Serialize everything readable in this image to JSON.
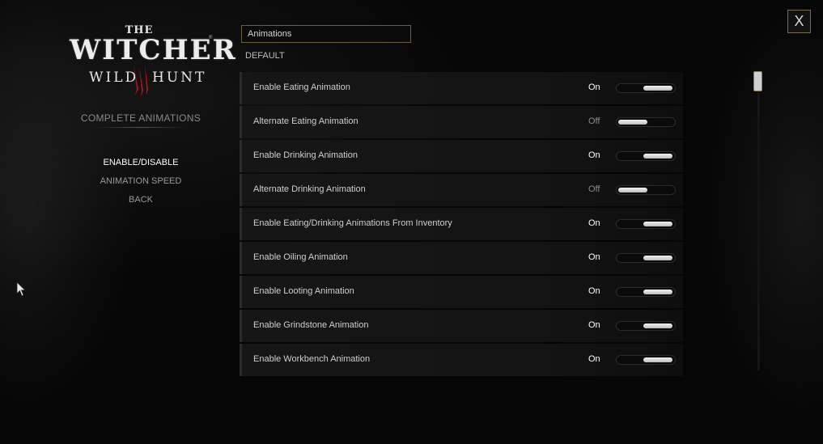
{
  "logo": {
    "the": "THE",
    "witcher": "WITCHER",
    "wild": "WILD",
    "hunt": "HUNT"
  },
  "menu": {
    "title": "COMPLETE ANIMATIONS",
    "items": [
      {
        "label": "ENABLE/DISABLE",
        "active": true
      },
      {
        "label": "ANIMATION SPEED",
        "active": false
      },
      {
        "label": "BACK",
        "active": false
      }
    ]
  },
  "search": {
    "value": "Animations"
  },
  "default_label": "DEFAULT",
  "close_label": "X",
  "colors": {
    "accent_border": "#7b6c4e",
    "on_text": "#ffffff",
    "off_text": "#8c8c8c"
  },
  "options": [
    {
      "label": "Enable Eating Animation",
      "state": "On"
    },
    {
      "label": "Alternate Eating Animation",
      "state": "Off"
    },
    {
      "label": "Enable Drinking Animation",
      "state": "On"
    },
    {
      "label": "Alternate Drinking Animation",
      "state": "Off"
    },
    {
      "label": "Enable Eating/Drinking Animations From Inventory",
      "state": "On"
    },
    {
      "label": "Enable Oiling Animation",
      "state": "On"
    },
    {
      "label": "Enable Looting Animation",
      "state": "On"
    },
    {
      "label": "Enable Grindstone Animation",
      "state": "On"
    },
    {
      "label": "Enable Workbench Animation",
      "state": "On"
    }
  ]
}
